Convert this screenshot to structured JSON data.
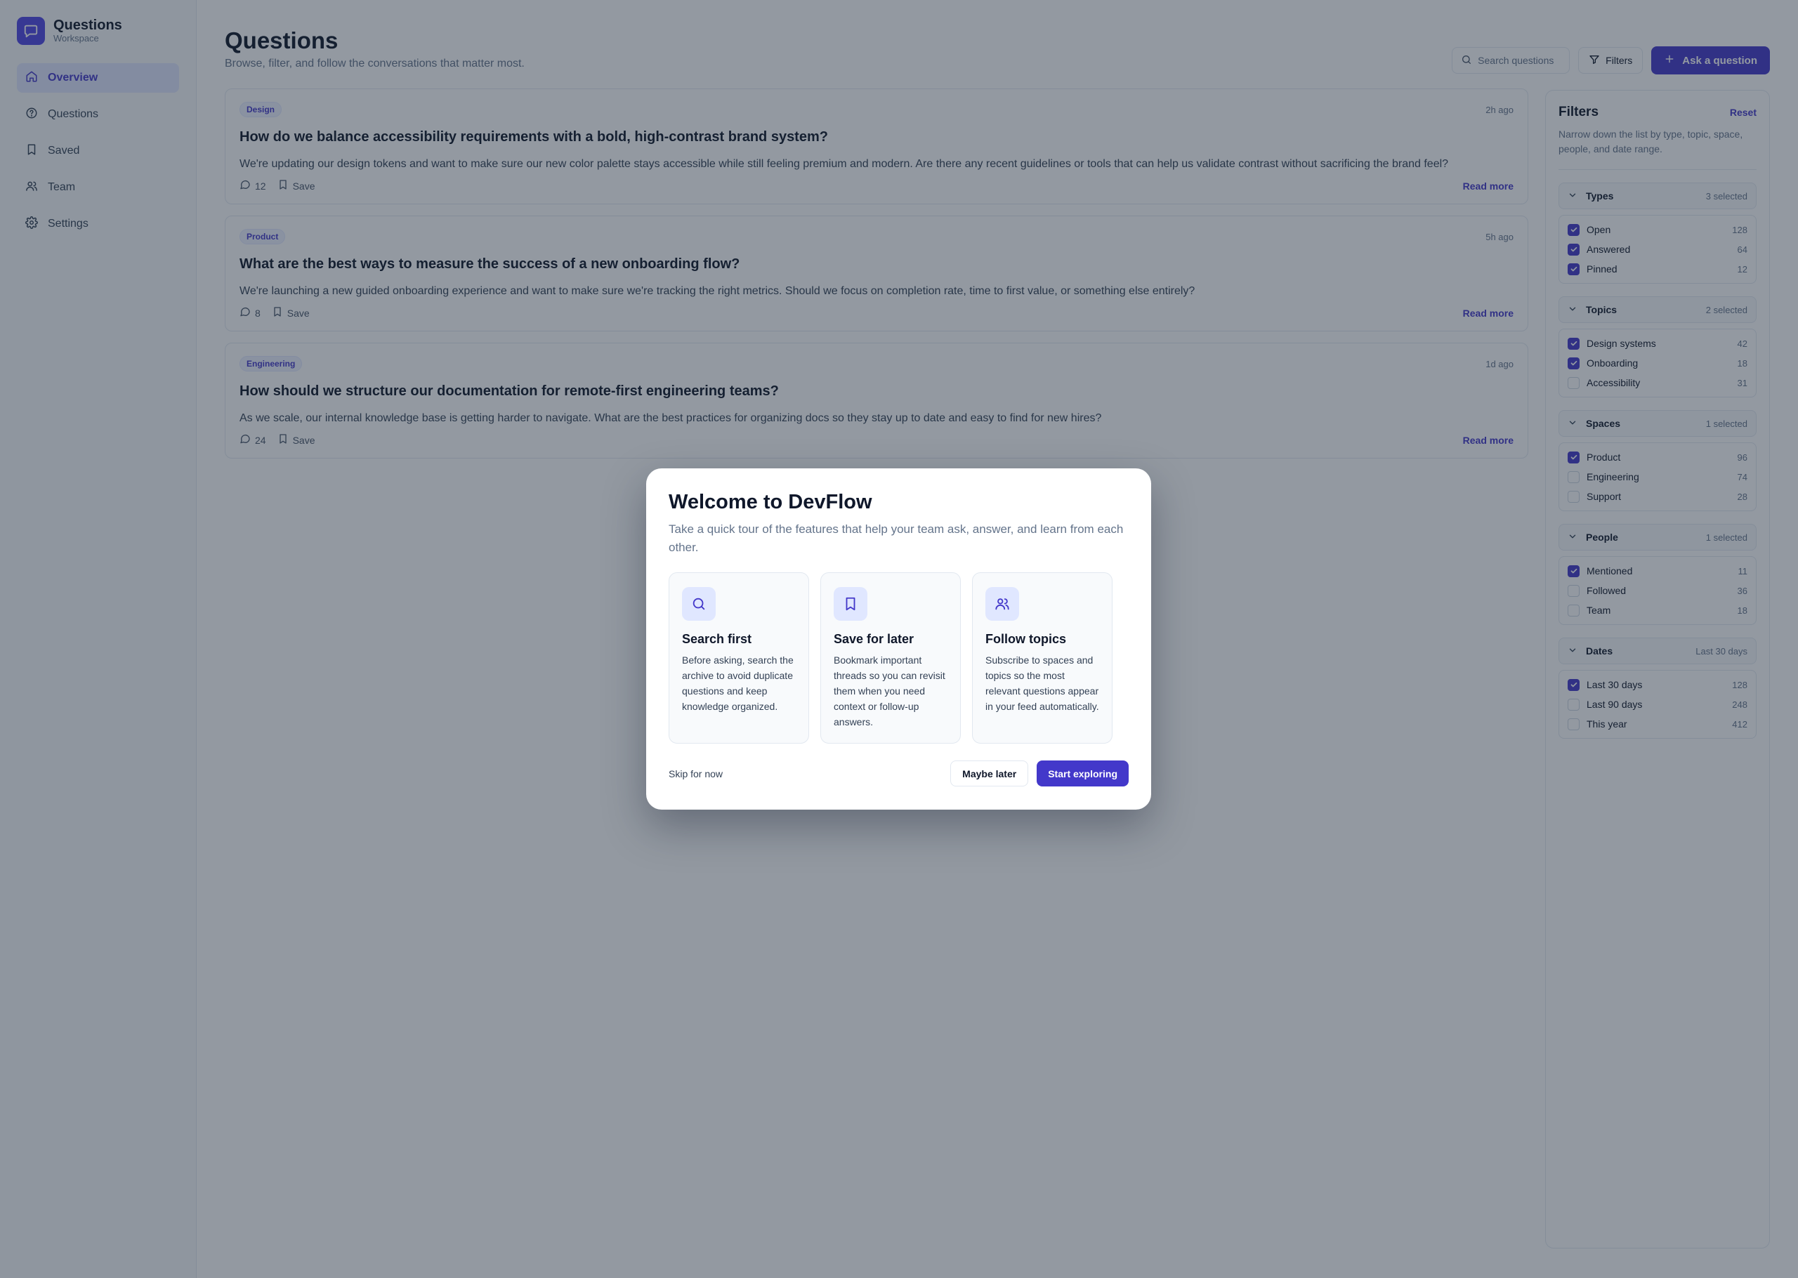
{
  "app": {
    "title": "Questions",
    "subtitle": "Workspace"
  },
  "nav": [
    {
      "label": "Overview",
      "icon": "home-icon",
      "active": true
    },
    {
      "label": "Questions",
      "icon": "help-circle-icon",
      "active": false
    },
    {
      "label": "Saved",
      "icon": "bookmark-icon",
      "active": false
    },
    {
      "label": "Team",
      "icon": "users-icon",
      "active": false
    },
    {
      "label": "Settings",
      "icon": "gear-icon",
      "active": false
    }
  ],
  "header": {
    "title": "Questions",
    "subtitle": "Browse, filter, and follow the conversations that matter most.",
    "search_placeholder": "Search questions",
    "filters_label": "Filters",
    "ask_label": "Ask a question"
  },
  "questions": [
    {
      "tag": "Design",
      "time": "2h ago",
      "title": "How do we balance accessibility requirements with a bold, high-contrast brand system?",
      "body": "We're updating our design tokens and want to make sure our new color palette stays accessible while still feeling premium and modern. Are there any recent guidelines or tools that can help us validate contrast without sacrificing the brand feel?",
      "comments": "12",
      "save": "Save",
      "read_more": "Read more"
    },
    {
      "tag": "Product",
      "time": "5h ago",
      "title": "What are the best ways to measure the success of a new onboarding flow?",
      "body": "We're launching a new guided onboarding experience and want to make sure we're tracking the right metrics. Should we focus on completion rate, time to first value, or something else entirely?",
      "comments": "8",
      "save": "Save",
      "read_more": "Read more"
    },
    {
      "tag": "Engineering",
      "time": "1d ago",
      "title": "How should we structure our documentation for remote-first engineering teams?",
      "body": "As we scale, our internal knowledge base is getting harder to navigate. What are the best practices for organizing docs so they stay up to date and easy to find for new hires?",
      "comments": "24",
      "save": "Save",
      "read_more": "Read more"
    }
  ],
  "filters": {
    "title": "Filters",
    "reset": "Reset",
    "subtitle": "Narrow down the list by type, topic, space, people, and date range.",
    "groups": [
      {
        "name": "Types",
        "count": "3 selected",
        "options": [
          {
            "label": "Open",
            "count": "128",
            "checked": true
          },
          {
            "label": "Answered",
            "count": "64",
            "checked": true
          },
          {
            "label": "Pinned",
            "count": "12",
            "checked": true
          }
        ]
      },
      {
        "name": "Topics",
        "count": "2 selected",
        "options": [
          {
            "label": "Design systems",
            "count": "42",
            "checked": true
          },
          {
            "label": "Onboarding",
            "count": "18",
            "checked": true
          },
          {
            "label": "Accessibility",
            "count": "31",
            "checked": false
          }
        ]
      },
      {
        "name": "Spaces",
        "count": "1 selected",
        "options": [
          {
            "label": "Product",
            "count": "96",
            "checked": true
          },
          {
            "label": "Engineering",
            "count": "74",
            "checked": false
          },
          {
            "label": "Support",
            "count": "28",
            "checked": false
          }
        ]
      },
      {
        "name": "People",
        "count": "1 selected",
        "options": [
          {
            "label": "Mentioned",
            "count": "11",
            "checked": true
          },
          {
            "label": "Followed",
            "count": "36",
            "checked": false
          },
          {
            "label": "Team",
            "count": "18",
            "checked": false
          }
        ]
      },
      {
        "name": "Dates",
        "count": "Last 30 days",
        "options": [
          {
            "label": "Last 30 days",
            "count": "128",
            "checked": true
          },
          {
            "label": "Last 90 days",
            "count": "248",
            "checked": false
          },
          {
            "label": "This year",
            "count": "412",
            "checked": false
          }
        ]
      }
    ]
  },
  "modal": {
    "title": "Welcome to DevFlow",
    "subtitle": "Take a quick tour of the features that help your team ask, answer, and learn from each other.",
    "features": [
      {
        "icon": "search-icon",
        "title": "Search first",
        "desc": "Before asking, search the archive to avoid duplicate questions and keep knowledge organized."
      },
      {
        "icon": "bookmark-icon",
        "title": "Save for later",
        "desc": "Bookmark important threads so you can revisit them when you need context or follow-up answers."
      },
      {
        "icon": "users-icon",
        "title": "Follow topics",
        "desc": "Subscribe to spaces and topics so the most relevant questions appear in your feed automatically."
      }
    ],
    "skip": "Skip for now",
    "maybe_later": "Maybe later",
    "start": "Start exploring"
  },
  "colors": {
    "accent": "#4338ca",
    "overlay": "rgba(30,41,59,0.48)"
  }
}
